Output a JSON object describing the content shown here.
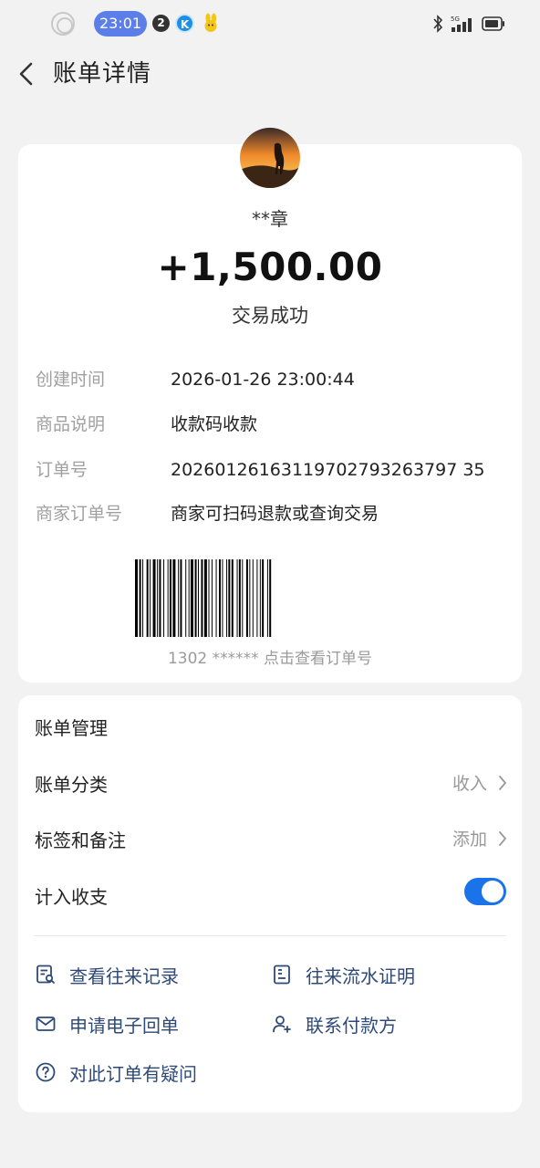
{
  "status_bar": {
    "time": "23:01",
    "notification_count": "2",
    "k_badge": "K",
    "network": "5G"
  },
  "header": {
    "title": "账单详情",
    "back_icon": "chevron-left-icon"
  },
  "transaction": {
    "payer_name": "**章",
    "amount": "+1,500.00",
    "status": "交易成功",
    "details": [
      {
        "label": "创建时间",
        "value": "2026-01-26 23:00:44"
      },
      {
        "label": "商品说明",
        "value": "收款码收款"
      },
      {
        "label": "订单号",
        "value": "20260126163119702793263797 35"
      },
      {
        "label": "商家订单号",
        "value": "商家可扫码退款或查询交易"
      }
    ],
    "barcode_caption": "1302 ****** 点击查看订单号"
  },
  "management": {
    "title": "账单管理",
    "category": {
      "label": "账单分类",
      "value": "收入"
    },
    "tags": {
      "label": "标签和备注",
      "value": "添加"
    },
    "count_in_budget": {
      "label": "计入收支",
      "enabled": true
    },
    "actions": [
      {
        "label": "查看往来记录",
        "icon": "records-search-icon"
      },
      {
        "label": "往来流水证明",
        "icon": "statement-icon"
      },
      {
        "label": "申请电子回单",
        "icon": "envelope-icon"
      },
      {
        "label": "联系付款方",
        "icon": "contact-person-icon"
      },
      {
        "label": "对此订单有疑问",
        "icon": "question-icon"
      }
    ]
  },
  "colors": {
    "accent": "#1a73e8",
    "status_time_pill": "#5b7ee8",
    "action_text": "#2e4a78",
    "background": "#f2f2f2"
  }
}
